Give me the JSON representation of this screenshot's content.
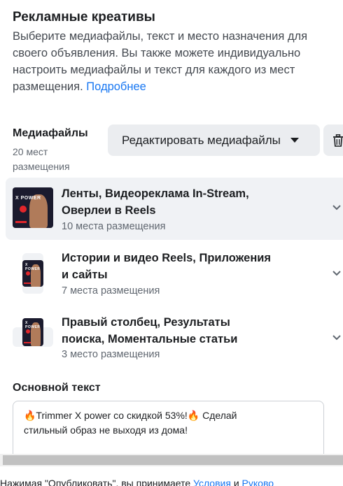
{
  "header": {
    "title": "Рекламные креативы",
    "description": "Выберите медиафайлы, текст и место назначения для своего объявления. Вы также можете индивидуально настроить медиафайлы и текст для каждого из мест размещения.",
    "more_link": "Подробнее"
  },
  "media": {
    "label": "Медиафайлы",
    "count": "20 мест размещения",
    "edit_button": "Редактировать медиафайлы",
    "edit_caret_icon": "caret-down-icon",
    "delete_icon": "trash-icon"
  },
  "placements": [
    {
      "title_line1": "Ленты, Видеореклама In-Stream,",
      "title_line2": "Оверлеи в Reels",
      "sub": "10 места размещения",
      "thumb_text": "X POWER",
      "selected": true
    },
    {
      "title_line1": "Истории и видео Reels, Приложения",
      "title_line2": "и сайты",
      "sub": "7 места размещения",
      "thumb_text": "X POWER",
      "selected": false
    },
    {
      "title_line1": "Правый столбец, Результаты",
      "title_line2": "поиска, Моментальные статьи",
      "sub": "3 место размещения",
      "thumb_text": "X POWER",
      "selected": false
    }
  ],
  "primary_text": {
    "label": "Основной текст",
    "line1": "🔥Trimmer X power со скидкой 53%!🔥 Сделай",
    "line2": "стильный образ не выходя из дома!"
  },
  "footer": {
    "text": "Нажимая \"Опубликовать\", вы принимаете ",
    "link1": "Условия",
    "mid": " и ",
    "link2": "Руково"
  },
  "colors": {
    "accent": "#1877f2",
    "button_bg": "#ebedf0",
    "selected_bg": "#f0f2f5"
  }
}
